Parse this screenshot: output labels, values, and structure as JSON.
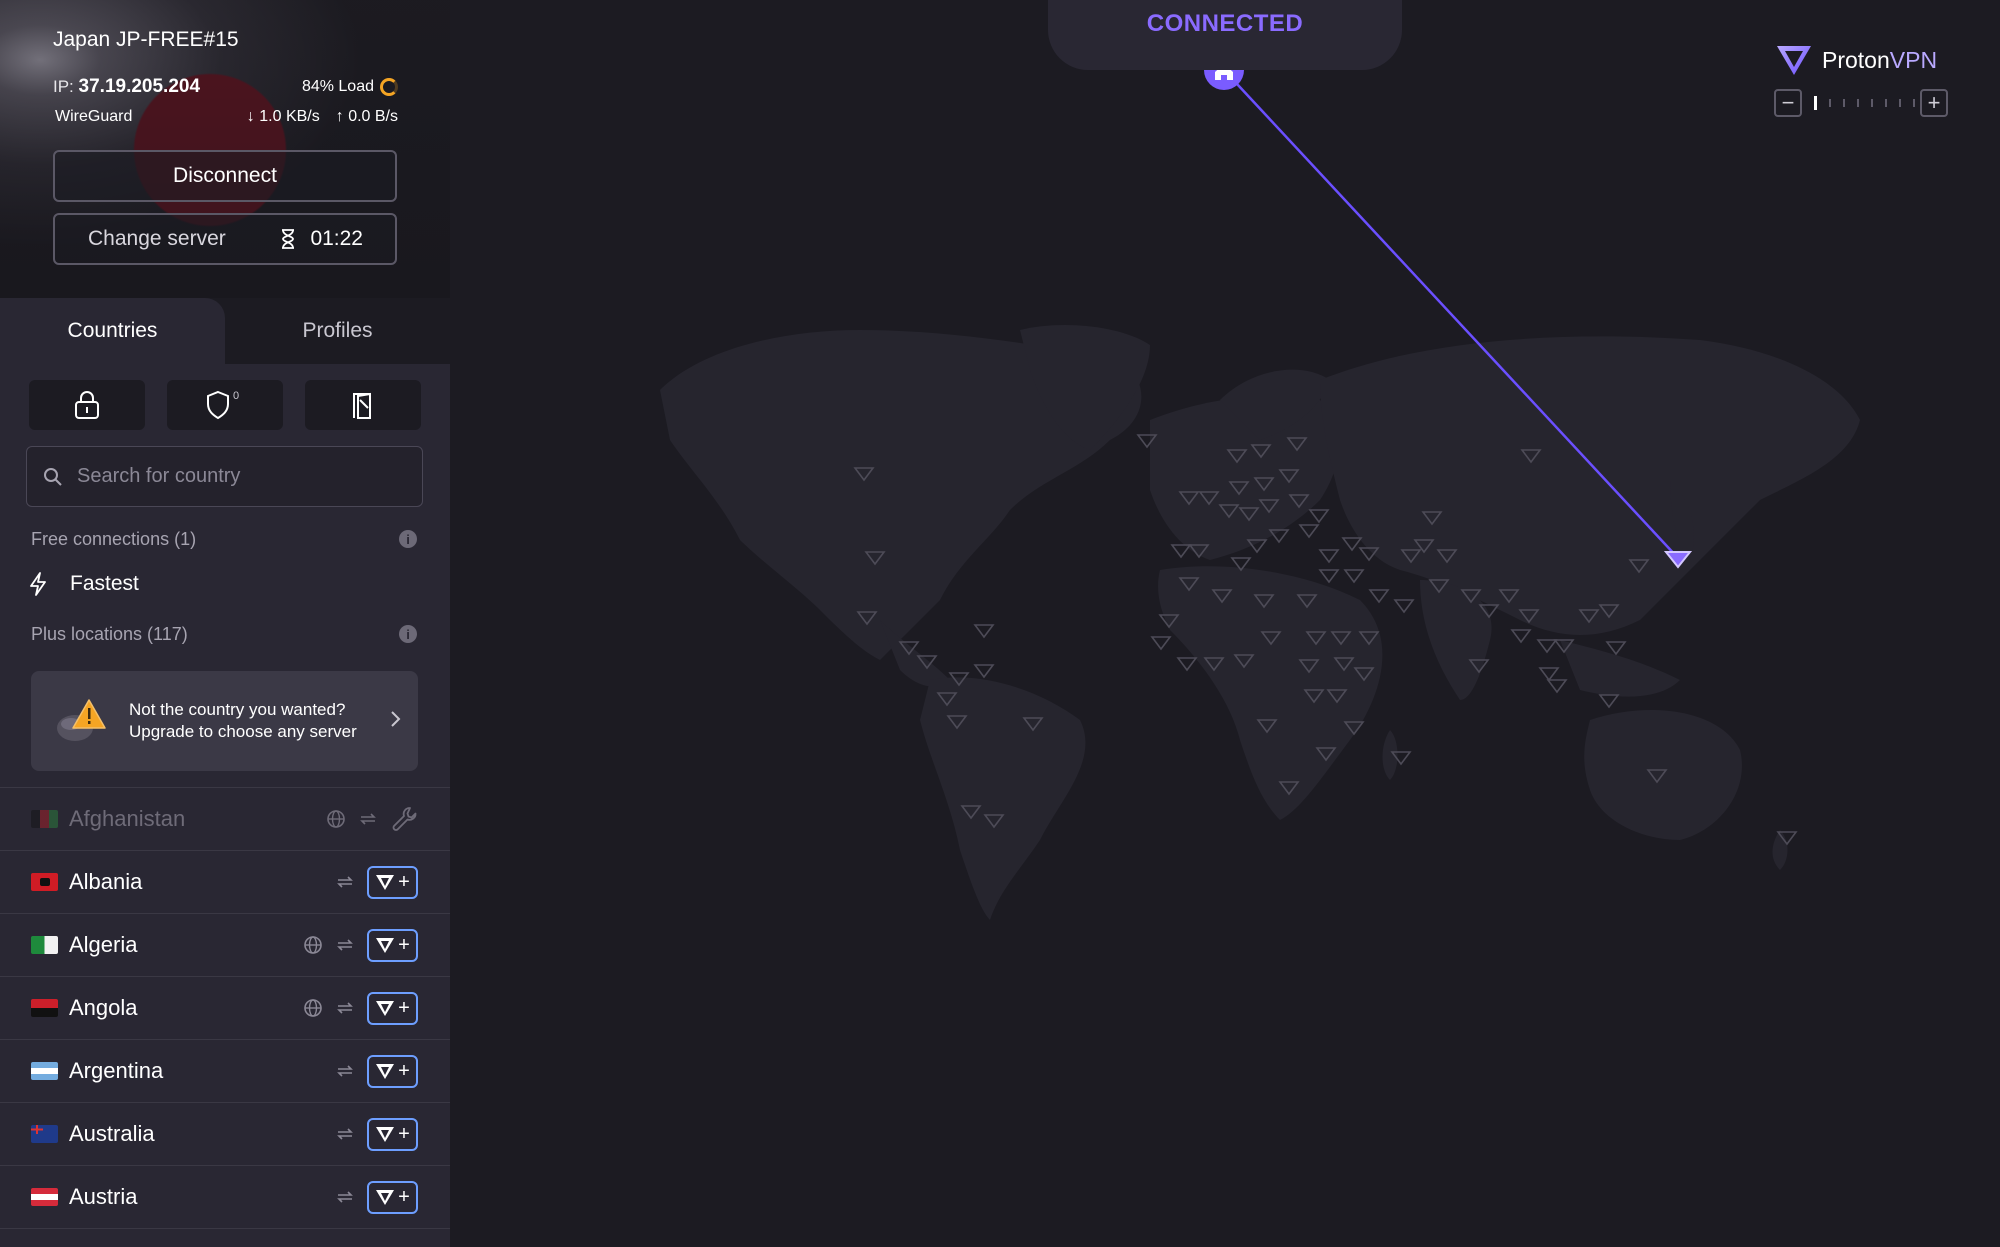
{
  "connection": {
    "server_name": "Japan JP-FREE#15",
    "ip_label": "IP:",
    "ip_value": "37.19.205.204",
    "load_text": "84% Load",
    "load_percent": 84,
    "protocol": "WireGuard",
    "download_speed": "1.0 KB/s",
    "upload_speed": "0.0 B/s",
    "disconnect_label": "Disconnect",
    "change_server_label": "Change server",
    "change_server_timer": "01:22"
  },
  "tabs": [
    {
      "label": "Countries",
      "active": true
    },
    {
      "label": "Profiles",
      "active": false
    }
  ],
  "filters": {
    "secure_core_icon": "lock-icon",
    "netshield_icon": "shield-icon",
    "netshield_count": "0",
    "killswitch_icon": "door-icon"
  },
  "search": {
    "placeholder": "Search for country",
    "value": ""
  },
  "free_section": {
    "label": "Free connections (1)",
    "fastest_label": "Fastest"
  },
  "plus_section": {
    "label": "Plus locations (117)"
  },
  "upgrade_banner": {
    "line1": "Not the country you wanted?",
    "line2": "Upgrade to choose any server"
  },
  "countries": [
    {
      "name": "Afghanistan",
      "disabled": true,
      "tor": true,
      "p2p": true,
      "wrench": true
    },
    {
      "name": "Albania",
      "disabled": false,
      "tor": false,
      "p2p": true,
      "upgrade": true
    },
    {
      "name": "Algeria",
      "disabled": false,
      "tor": true,
      "p2p": true,
      "upgrade": true
    },
    {
      "name": "Angola",
      "disabled": false,
      "tor": true,
      "p2p": true,
      "upgrade": true
    },
    {
      "name": "Argentina",
      "disabled": false,
      "tor": false,
      "p2p": true,
      "upgrade": true
    },
    {
      "name": "Australia",
      "disabled": false,
      "tor": false,
      "p2p": true,
      "upgrade": true
    },
    {
      "name": "Austria",
      "disabled": false,
      "tor": false,
      "p2p": true,
      "upgrade": true
    }
  ],
  "map": {
    "status": "CONNECTED",
    "brand_proton": "Proton",
    "brand_vpn": "VPN",
    "accent_color": "#8a6bff"
  }
}
